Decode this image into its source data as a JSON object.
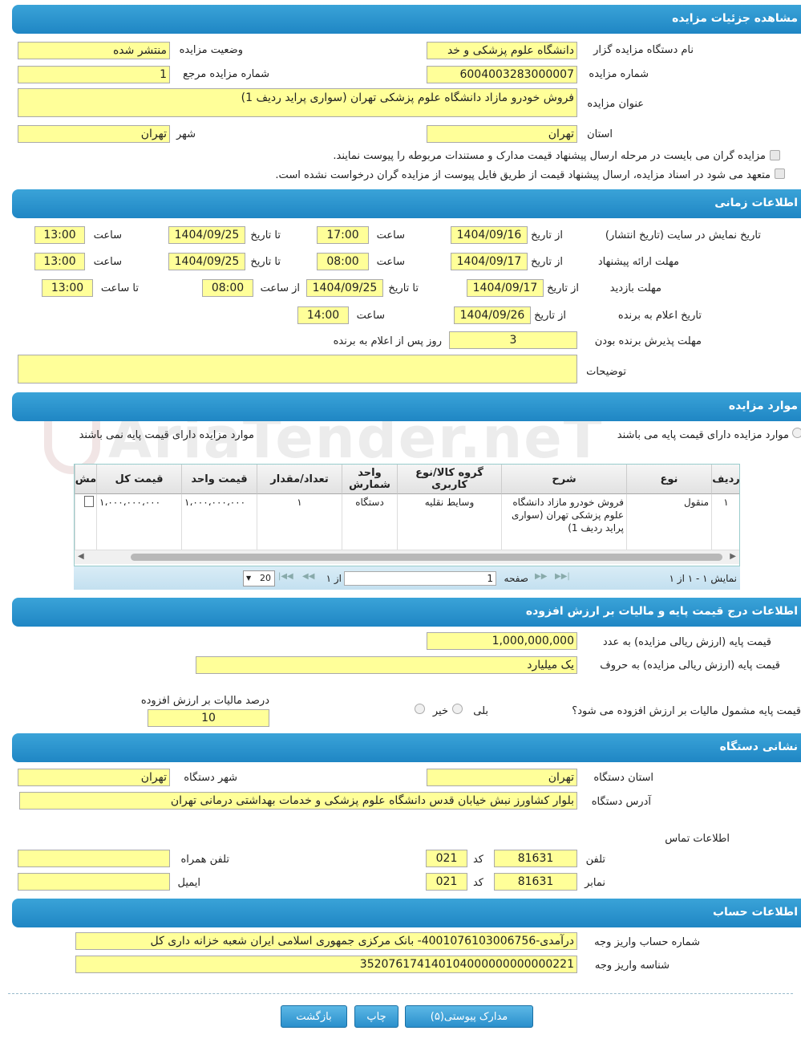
{
  "watermark": "AriaTender.neT",
  "sections": {
    "details": "مشاهده جزئیات مزایده",
    "time": "اطلاعات زمانی",
    "items": "موارد مزایده",
    "price": "اطلاعات درج قیمت پایه و مالیات بر ارزش افزوده",
    "address": "نشانی دستگاه",
    "account": "اطلاعات حساب"
  },
  "details": {
    "org_label": "نام دستگاه مزایده گزار",
    "org_value": "دانشگاه علوم پزشکی و خد",
    "status_label": "وضعیت مزایده",
    "status_value": "منتشر شده",
    "number_label": "شماره مزایده",
    "number_value": "6004003283000007",
    "ref_label": "شماره مزایده مرجع",
    "ref_value": "1",
    "title_label": "عنوان مزایده",
    "title_value": "فروش خودرو مازاد دانشگاه علوم پزشکی تهران (سواری پراید ردیف 1)",
    "province_label": "استان",
    "province_value": "تهران",
    "city_label": "شهر",
    "city_value": "تهران",
    "check1": "مزایده گران می بایست در مرحله ارسال پیشنهاد قیمت مدارک و مستندات مربوطه را پیوست نمایند.",
    "check2": "متعهد می شود در اسناد مزایده، ارسال پیشنهاد قیمت از طریق فایل پیوست از مزایده گران درخواست نشده است."
  },
  "time": {
    "display_label": "تاریخ نمایش در سایت (تاریخ انتشار)",
    "offer_label": "مهلت ارائه پیشنهاد",
    "visit_label": "مهلت بازدید",
    "announce_label": "تاریخ اعلام به برنده",
    "accept_label": "مهلت پذیرش برنده بودن",
    "desc_label": "توضیحات",
    "from_date": "از تاریخ",
    "to_date": "تا تاریخ",
    "hour": "ساعت",
    "from_hour": "از ساعت",
    "to_hour": "تا ساعت",
    "days_after": "روز پس از اعلام به برنده",
    "display_from": "1404/09/16",
    "display_from_time": "17:00",
    "display_to": "1404/09/25",
    "display_to_time": "13:00",
    "offer_from": "1404/09/17",
    "offer_from_time": "08:00",
    "offer_to": "1404/09/25",
    "offer_to_time": "13:00",
    "visit_from": "1404/09/17",
    "visit_to": "1404/09/25",
    "visit_from_time": "08:00",
    "visit_to_time": "13:00",
    "announce_date": "1404/09/26",
    "announce_time": "14:00",
    "accept_days": "3",
    "desc_value": ""
  },
  "items": {
    "radio_with": "موارد مزایده دارای قیمت پایه می باشند",
    "radio_without": "موارد مزایده دارای قیمت پایه نمی باشند",
    "columns": [
      "ردیف",
      "نوع",
      "شرح",
      "گروه کالا/نوع کاربری",
      "واحد شمارش",
      "تعداد/مقدار",
      "قیمت واحد",
      "قیمت کل",
      "مش"
    ],
    "row": [
      "۱",
      "منقول",
      "فروش خودرو مازاد دانشگاه علوم پزشکی تهران (سواری پراید ردیف 1)",
      "وسایط نقلیه",
      "دستگاه",
      "۱",
      "۱،۰۰۰،۰۰۰،۰۰۰",
      "۱،۰۰۰،۰۰۰،۰۰۰"
    ],
    "pager_showing": "نمایش ۱ - ۱ از ۱",
    "pager_page": "صفحه",
    "pager_page_value": "1",
    "pager_of": "از ۱",
    "pager_size": "20"
  },
  "price": {
    "num_label": "قیمت پایه (ارزش ریالی مزایده) به عدد",
    "num_value": "1,000,000,000",
    "text_label": "قیمت پایه (ارزش ریالی مزایده) به حروف",
    "text_value": "یک میلیارد",
    "vat_q": "قیمت پایه مشمول مالیات بر ارزش افزوده می شود؟",
    "yes": "بلی",
    "no": "خیر",
    "vat_pct_label": "درصد مالیات بر ارزش افزوده",
    "vat_pct_value": "10"
  },
  "address": {
    "province_label": "استان دستگاه",
    "province_value": "تهران",
    "city_label": "شهر دستگاه",
    "city_value": "تهران",
    "addr_label": "آدرس دستگاه",
    "addr_value": "بلوار کشاورز نبش خیابان قدس دانشگاه علوم پزشکی و خدمات بهداشتی درمانی تهران",
    "contact_label": "اطلاعات تماس",
    "phone_label": "تلفن",
    "phone_value": "81631",
    "code_label": "کد",
    "code_value": "021",
    "mobile_label": "تلفن همراه",
    "mobile_value": "",
    "fax_label": "نمابر",
    "fax_value": "81631",
    "fax_code_value": "021",
    "email_label": "ایمیل",
    "email_value": ""
  },
  "account": {
    "acc_label": "شماره حساب واریز وجه",
    "acc_value": "درآمدی-4001076103006756- بانک مرکزی جمهوری اسلامی ایران شعبه خزانه داری کل",
    "id_label": "شناسه واریز وجه",
    "id_value": "352076174140104000000000000221"
  },
  "buttons": {
    "docs": "مدارک پیوستی(۵)",
    "print": "چاپ",
    "back": "بازگشت"
  }
}
